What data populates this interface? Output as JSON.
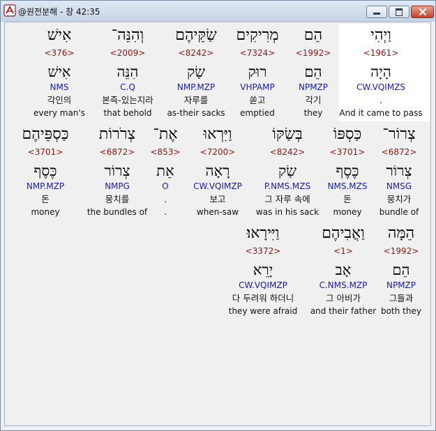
{
  "window": {
    "title": "@원전분해 - 창 42:35",
    "buttons": [
      "minimize",
      "maximize",
      "close"
    ]
  },
  "icons": {
    "app": "app-logo-icon",
    "minimize": "minimize-icon",
    "maximize": "maximize-icon",
    "close": "close-icon"
  },
  "rows": [
    {
      "words": [
        {
          "hebrew": "וַיְהִי",
          "strong": "<1961>",
          "lexeme": "הָיָה",
          "parsing": "CW.VQIMZS",
          "korean": ".",
          "english": "And it came to pass"
        },
        {
          "hebrew": "הֵם",
          "strong": "<1992>",
          "lexeme": "הֵם",
          "parsing": "NPMZP",
          "korean": "각기",
          "english": "they"
        },
        {
          "hebrew": "מְרִיקִים",
          "strong": "<7324>",
          "lexeme": "רוּק",
          "parsing": "VHPAMP",
          "korean": "쏟고",
          "english": "emptied"
        },
        {
          "hebrew": "שַׂקֵּיהֶם",
          "strong": "<8242>",
          "lexeme": "שַׂק",
          "parsing": "NMP.MZP",
          "korean": "자루를",
          "english": "as-their sacks"
        },
        {
          "hebrew": "וְהִנֵּה־",
          "strong": "<2009>",
          "lexeme": "הִנֵּה",
          "parsing": "C.Q",
          "korean": "본즉-있는지라",
          "english": "that behold"
        },
        {
          "hebrew": "אִישׁ",
          "strong": "<376>",
          "lexeme": "אִישׁ",
          "parsing": "NMS",
          "korean": "각인의",
          "english": "every man's"
        }
      ]
    },
    {
      "words": [
        {
          "hebrew": "צְרוֹר־",
          "strong": "<6872>",
          "lexeme": "צְרוֹר",
          "parsing": "NMSG",
          "korean": "뭉치가",
          "english": "bundle of"
        },
        {
          "hebrew": "כַּסְפּוֹ",
          "strong": "<3701>",
          "lexeme": "כֶּסֶף",
          "parsing": "NMS.MZS",
          "korean": "돈",
          "english": "money"
        },
        {
          "hebrew": "בְּשַׂקּוֹ",
          "strong": "<8242>",
          "lexeme": "שַׂק",
          "parsing": "P.NMS.MZS",
          "korean": "그 자루 속에",
          "english": "was in his sack"
        },
        {
          "hebrew": "וַיִּרְאוּ",
          "strong": "<7200>",
          "lexeme": "רָאָה",
          "parsing": "CW.VQIMZP",
          "korean": "보고",
          "english": "when-saw"
        },
        {
          "hebrew": "אֶת־",
          "strong": "<853>",
          "lexeme": "אֵת",
          "parsing": "O",
          "korean": ".",
          "english": "."
        },
        {
          "hebrew": "צְרֹרוֹת",
          "strong": "<6872>",
          "lexeme": "צְרוֹר",
          "parsing": "NMPG",
          "korean": "뭉치를",
          "english": "the bundles of"
        },
        {
          "hebrew": "כַּסְפֵּיהֶם",
          "strong": "<3701>",
          "lexeme": "כֶּסֶף",
          "parsing": "NMP.MZP",
          "korean": "돈",
          "english": "money"
        }
      ]
    },
    {
      "words": [
        {
          "hebrew": "הֵמָּה",
          "strong": "<1992>",
          "lexeme": "הֵם",
          "parsing": "NPMZP",
          "korean": "그들과",
          "english": "both they"
        },
        {
          "hebrew": "וַאֲבִיהֶם",
          "strong": "<1>",
          "lexeme": "אָב",
          "parsing": "C.NMS.MZP",
          "korean": "그 아비가",
          "english": "and their father"
        },
        {
          "hebrew": "וַיִּירָאוּ׃",
          "strong": "<3372>",
          "lexeme": "יָרֵא",
          "parsing": "CW.VQIMZP",
          "korean": "다 두려워 하더니",
          "english": "they were afraid"
        }
      ]
    }
  ]
}
